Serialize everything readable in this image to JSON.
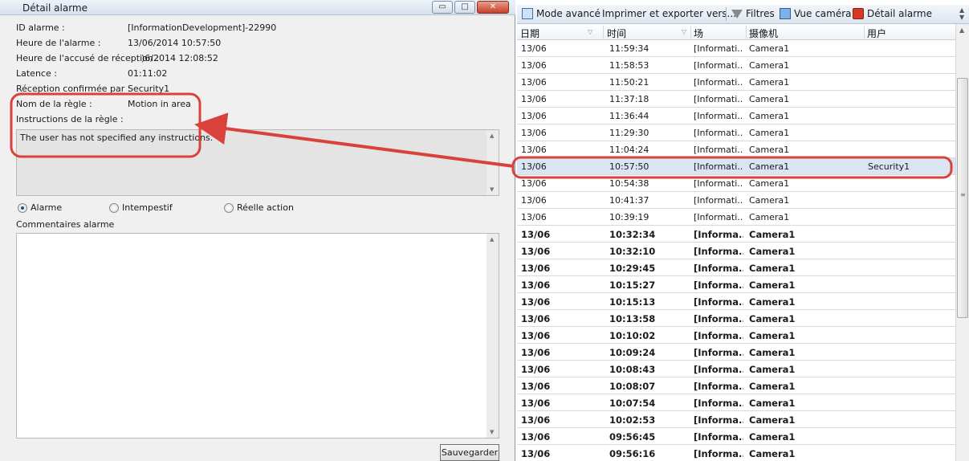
{
  "window": {
    "title": "Détail alarme",
    "minimize_glyph": "▭",
    "maximize_glyph": "□",
    "close_glyph": "✕"
  },
  "details": {
    "fields": [
      {
        "label": "ID alarme :",
        "value": "[InformationDevelopment]-22990"
      },
      {
        "label": "Heure de l'alarme :",
        "value": "13/06/2014 10:57:50"
      },
      {
        "label": "Heure de l'accusé de réception :",
        "value": ")6/2014 12:08:52"
      },
      {
        "label": "Latence :",
        "value": "01:11:02"
      },
      {
        "label": "Réception confirmée par :",
        "value": "Security1"
      },
      {
        "label": "Nom de la règle :",
        "value": "Motion in area"
      },
      {
        "label": "Instructions de la règle :",
        "value": ""
      }
    ],
    "instructions_text": "The user has not specified any instructions."
  },
  "classification": {
    "options": [
      {
        "label": "Alarme",
        "selected": true
      },
      {
        "label": "Intempestif",
        "selected": false
      },
      {
        "label": "Réelle action",
        "selected": false
      }
    ]
  },
  "comments": {
    "label": "Commentaires alarme",
    "value": ""
  },
  "save_button": "Sauvegarder",
  "toolbar": {
    "advanced_mode": "Mode avancé",
    "print_export": "Imprimer et exporter vers....",
    "filters": "Filtres",
    "camera_view": "Vue caméra",
    "alarm_detail": "Détail alarme"
  },
  "table": {
    "columns": [
      "日期",
      "时间",
      "场",
      "摄像机",
      "用户"
    ],
    "rows": [
      {
        "date": "13/06",
        "time": "11:59:34",
        "site": "[Informati...",
        "camera": "Camera1",
        "user": "",
        "bold": false,
        "selected": false
      },
      {
        "date": "13/06",
        "time": "11:58:53",
        "site": "[Informati...",
        "camera": "Camera1",
        "user": "",
        "bold": false,
        "selected": false
      },
      {
        "date": "13/06",
        "time": "11:50:21",
        "site": "[Informati...",
        "camera": "Camera1",
        "user": "",
        "bold": false,
        "selected": false
      },
      {
        "date": "13/06",
        "time": "11:37:18",
        "site": "[Informati...",
        "camera": "Camera1",
        "user": "",
        "bold": false,
        "selected": false
      },
      {
        "date": "13/06",
        "time": "11:36:44",
        "site": "[Informati...",
        "camera": "Camera1",
        "user": "",
        "bold": false,
        "selected": false
      },
      {
        "date": "13/06",
        "time": "11:29:30",
        "site": "[Informati...",
        "camera": "Camera1",
        "user": "",
        "bold": false,
        "selected": false
      },
      {
        "date": "13/06",
        "time": "11:04:24",
        "site": "[Informati...",
        "camera": "Camera1",
        "user": "",
        "bold": false,
        "selected": false
      },
      {
        "date": "13/06",
        "time": "10:57:50",
        "site": "[Informati...",
        "camera": "Camera1",
        "user": "Security1",
        "bold": false,
        "selected": true
      },
      {
        "date": "13/06",
        "time": "10:54:38",
        "site": "[Informati...",
        "camera": "Camera1",
        "user": "",
        "bold": false,
        "selected": false
      },
      {
        "date": "13/06",
        "time": "10:41:37",
        "site": "[Informati...",
        "camera": "Camera1",
        "user": "",
        "bold": false,
        "selected": false
      },
      {
        "date": "13/06",
        "time": "10:39:19",
        "site": "[Informati...",
        "camera": "Camera1",
        "user": "",
        "bold": false,
        "selected": false
      },
      {
        "date": "13/06",
        "time": "10:32:34",
        "site": "[Informa...",
        "camera": "Camera1",
        "user": "",
        "bold": true,
        "selected": false
      },
      {
        "date": "13/06",
        "time": "10:32:10",
        "site": "[Informa...",
        "camera": "Camera1",
        "user": "",
        "bold": true,
        "selected": false
      },
      {
        "date": "13/06",
        "time": "10:29:45",
        "site": "[Informa...",
        "camera": "Camera1",
        "user": "",
        "bold": true,
        "selected": false
      },
      {
        "date": "13/06",
        "time": "10:15:27",
        "site": "[Informa...",
        "camera": "Camera1",
        "user": "",
        "bold": true,
        "selected": false
      },
      {
        "date": "13/06",
        "time": "10:15:13",
        "site": "[Informa...",
        "camera": "Camera1",
        "user": "",
        "bold": true,
        "selected": false
      },
      {
        "date": "13/06",
        "time": "10:13:58",
        "site": "[Informa...",
        "camera": "Camera1",
        "user": "",
        "bold": true,
        "selected": false
      },
      {
        "date": "13/06",
        "time": "10:10:02",
        "site": "[Informa...",
        "camera": "Camera1",
        "user": "",
        "bold": true,
        "selected": false
      },
      {
        "date": "13/06",
        "time": "10:09:24",
        "site": "[Informa...",
        "camera": "Camera1",
        "user": "",
        "bold": true,
        "selected": false
      },
      {
        "date": "13/06",
        "time": "10:08:43",
        "site": "[Informa...",
        "camera": "Camera1",
        "user": "",
        "bold": true,
        "selected": false
      },
      {
        "date": "13/06",
        "time": "10:08:07",
        "site": "[Informa...",
        "camera": "Camera1",
        "user": "",
        "bold": true,
        "selected": false
      },
      {
        "date": "13/06",
        "time": "10:07:54",
        "site": "[Informa...",
        "camera": "Camera1",
        "user": "",
        "bold": true,
        "selected": false
      },
      {
        "date": "13/06",
        "time": "10:02:53",
        "site": "[Informa...",
        "camera": "Camera1",
        "user": "",
        "bold": true,
        "selected": false
      },
      {
        "date": "13/06",
        "time": "09:56:45",
        "site": "[Informa...",
        "camera": "Camera1",
        "user": "",
        "bold": true,
        "selected": false
      },
      {
        "date": "13/06",
        "time": "09:56:16",
        "site": "[Informa...",
        "camera": "Camera1",
        "user": "",
        "bold": true,
        "selected": false
      }
    ]
  },
  "colors": {
    "annotation_red": "#d9423c",
    "selected_row": "#d9e5f3"
  }
}
